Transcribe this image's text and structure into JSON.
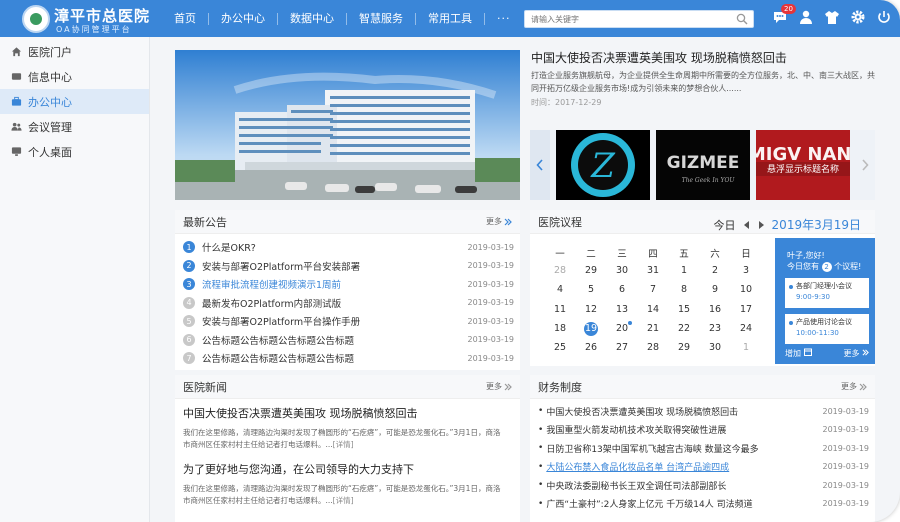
{
  "header": {
    "brand": "漳平市总医院",
    "subtitle": "OA协同管理平台",
    "nav": [
      "首页",
      "办公中心",
      "数据中心",
      "智慧服务",
      "常用工具"
    ],
    "more": "···",
    "search_placeholder": "请输入关键字",
    "message_badge": "20"
  },
  "sidebar": {
    "items": [
      {
        "label": "医院门户",
        "icon": "home-icon"
      },
      {
        "label": "信息中心",
        "icon": "card-icon"
      },
      {
        "label": "办公中心",
        "icon": "briefcase-icon"
      },
      {
        "label": "会议管理",
        "icon": "users-icon"
      },
      {
        "label": "个人桌面",
        "icon": "monitor-icon"
      }
    ],
    "active_index": 2
  },
  "hero": {
    "headline": "中国大使投否决票遭英美围攻 现场脱稿愤怒回击",
    "desc": "打造企业服务旗舰航母，为企业提供全生命周期中所需要的全方位服务，北、中、南三大战区，共同开拓万亿级企业服务市场!成为引领未来的梦想合伙人......",
    "time": "时间：2017-12-29",
    "thumbs": [
      "Z",
      "GIZMEE",
      "MIGV NANI"
    ],
    "thumb_tagline": "The Geek In YOU",
    "thumb_caption": "悬浮显示标题名称"
  },
  "announcements": {
    "title": "最新公告",
    "more": "更多",
    "items": [
      {
        "n": "1",
        "text": "什么是OKR?",
        "date": "2019-03-19"
      },
      {
        "n": "2",
        "text": "安装与部署O2Platform平台安装部署",
        "date": "2019-03-19"
      },
      {
        "n": "3",
        "text": "流程审批流程创建视频演示1周前",
        "date": "2019-03-19"
      },
      {
        "n": "4",
        "text": "最新发布O2Platform内部测试版",
        "date": "2019-03-19"
      },
      {
        "n": "5",
        "text": "安装与部署O2Platform平台操作手册",
        "date": "2019-03-19"
      },
      {
        "n": "6",
        "text": "公告标题公告标题公告标题公告标题",
        "date": "2019-03-19"
      },
      {
        "n": "7",
        "text": "公告标题公告标题公告标题公告标题",
        "date": "2019-03-19"
      }
    ]
  },
  "calendar": {
    "title": "医院议程",
    "today_label": "今日",
    "date_label": "2019年3月19日",
    "weekdays": [
      "一",
      "二",
      "三",
      "四",
      "五",
      "六",
      "日"
    ],
    "weeks": [
      [
        "28",
        "29",
        "30",
        "31",
        "1",
        "2",
        "3"
      ],
      [
        "4",
        "5",
        "6",
        "7",
        "8",
        "9",
        "10"
      ],
      [
        "11",
        "12",
        "13",
        "14",
        "15",
        "16",
        "17"
      ],
      [
        "18",
        "19",
        "20",
        "21",
        "22",
        "23",
        "24"
      ],
      [
        "25",
        "26",
        "27",
        "28",
        "29",
        "30",
        "1"
      ]
    ],
    "agenda": {
      "greeting": "叶子,您好!",
      "today_prefix": "今日您有",
      "count": "2",
      "today_suffix": "个议程!",
      "events": [
        {
          "title": "各部门经理小会议",
          "time": "9:00-9:30"
        },
        {
          "title": "产品使用讨论会议",
          "time": "10:00-11:30"
        }
      ],
      "add": "增加",
      "more": "更多"
    }
  },
  "news": {
    "title": "医院新闻",
    "more": "更多",
    "items": [
      {
        "title": "中国大使投否决票遭英美围攻 现场脱稿愤怒回击",
        "desc": "我们在这里修路，清理路边沟渠时发现了椭圆形的“石疙瘩”，可能是恐龙蛋化石。”3月1日，商洛市商州区任家村村主任给记者打电话爆料。...",
        "link": "[详情]"
      },
      {
        "title": "为了更好地与您沟通，在公司领导的大力支持下",
        "desc": "我们在这里修路，清理路边沟渠时发现了椭圆形的“石疙瘩”，可能是恐龙蛋化石。”3月1日，商洛市商州区任家村村主任给记者打电话爆料。...",
        "link": "[详情]"
      }
    ]
  },
  "finance": {
    "title": "财务制度",
    "more": "更多",
    "items": [
      {
        "text": "中国大使投否决票遭英美围攻 现场脱稿愤怒回击",
        "date": "2019-03-19"
      },
      {
        "text": "我国重型火箭发动机技术攻关取得突破性进展",
        "date": "2019-03-19"
      },
      {
        "text": "日防卫省称13架中国军机飞越宫古海峡 数量这今最多",
        "date": "2019-03-19"
      },
      {
        "text": "大陆公布禁入食品化妆品名单 台湾产品逾四成",
        "date": "2019-03-19"
      },
      {
        "text": "中央政法委副秘书长王双全调任司法部副部长",
        "date": "2019-03-19"
      },
      {
        "text": "广西“土豪村”:2人身家上亿元 千万级14人 司法频道",
        "date": "2019-03-19"
      }
    ]
  }
}
